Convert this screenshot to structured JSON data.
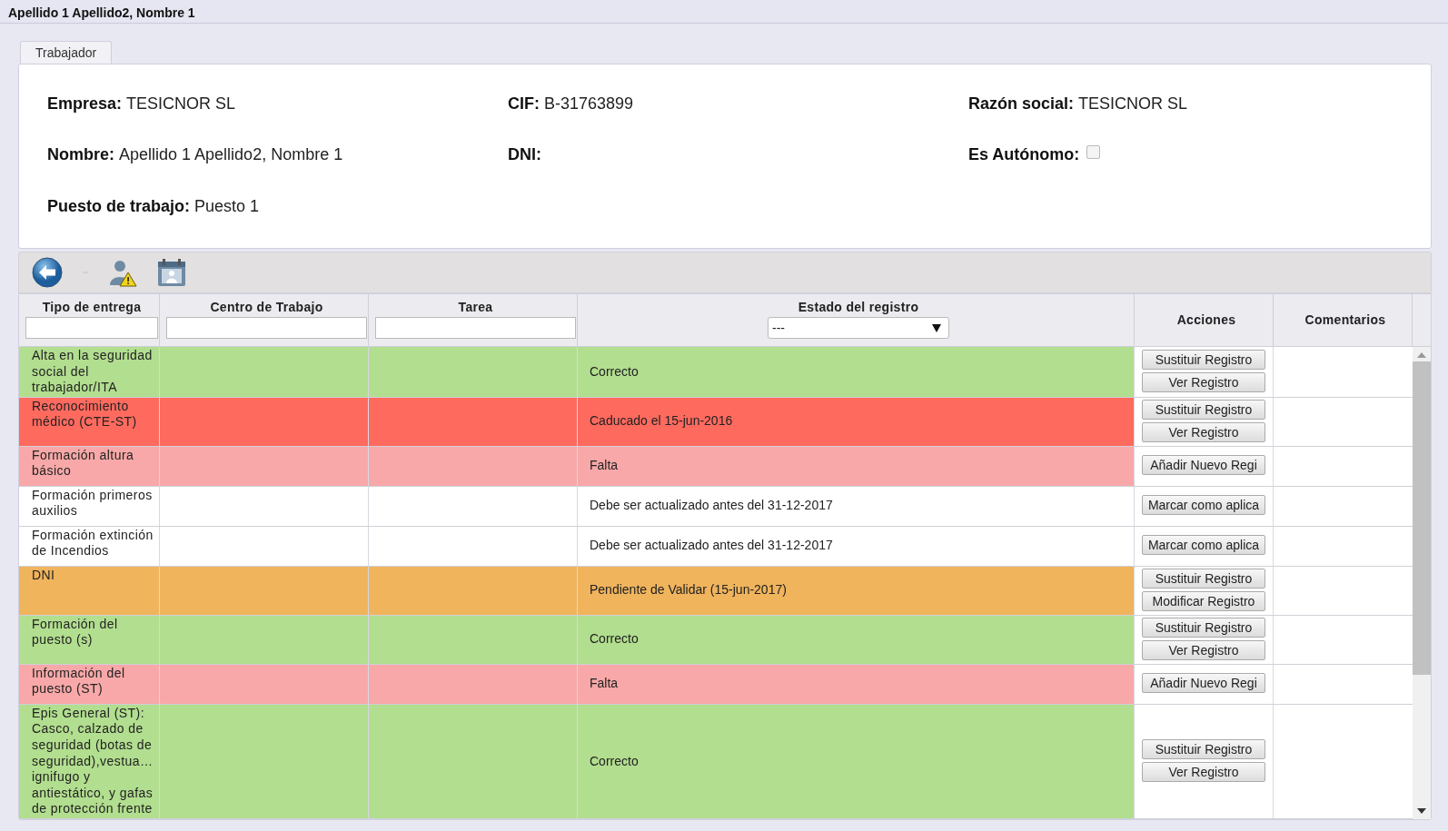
{
  "window": {
    "title": "Apellido 1 Apellido2, Nombre 1"
  },
  "tabs": [
    {
      "label": "Trabajador",
      "selected": true
    }
  ],
  "info": [
    {
      "kind": "text",
      "label": "Empresa:",
      "value": "TESICNOR SL"
    },
    {
      "kind": "text",
      "label": "CIF:",
      "value": "B-31763899"
    },
    {
      "kind": "text",
      "label": "Razón social:",
      "value": "TESICNOR SL"
    },
    {
      "kind": "text",
      "label": "Nombre:",
      "value": "Apellido 1 Apellido2, Nombre 1"
    },
    {
      "kind": "text",
      "label": "DNI:"
    },
    {
      "kind": "checkbox",
      "label": "Es Autónomo:",
      "checked": false
    },
    {
      "kind": "text",
      "label": "Puesto de trabajo:",
      "value": "Puesto 1"
    }
  ],
  "table": {
    "columns": [
      {
        "label": "Tipo de entrega",
        "kind": "text-filter"
      },
      {
        "label": "Centro de Trabajo",
        "kind": "text-filter"
      },
      {
        "label": "Tarea",
        "kind": "text-filter"
      },
      {
        "label": "Estado del registro",
        "kind": "select-filter",
        "value": "---"
      },
      {
        "label": "Acciones",
        "kind": "plain"
      },
      {
        "label": "Comentarios",
        "kind": "plain"
      }
    ],
    "rows": [
      {
        "tipo": "Alta en la seguridad social del trabajador/ITA",
        "estado": "Correcto",
        "color": "#b2de8f",
        "actions": [
          "Sustituir Registro",
          "Ver Registro"
        ]
      },
      {
        "tipo": "Reconocimiento médico (CTE-ST)",
        "estado": "Caducado el 15-jun-2016",
        "color": "#ff6a5f",
        "actions": [
          "Sustituir Registro",
          "Ver Registro"
        ]
      },
      {
        "tipo": "Formación altura básico",
        "estado": "Falta",
        "color": "#f8a8a8",
        "actions": [
          "Añadir Nuevo Regi"
        ]
      },
      {
        "tipo": "Formación primeros auxilios",
        "estado": "Debe ser actualizado antes del 31-12-2017",
        "color": "#ffffff",
        "actions": [
          "Marcar como aplica"
        ]
      },
      {
        "tipo": "Formación extinción de Incendios",
        "estado": "Debe ser actualizado antes del 31-12-2017",
        "color": "#ffffff",
        "actions": [
          "Marcar como aplica"
        ]
      },
      {
        "tipo": "DNI",
        "estado": "Pendiente de Validar (15-jun-2017)",
        "color": "#f0b45d",
        "actions": [
          "Sustituir Registro",
          "Modificar Registro"
        ]
      },
      {
        "tipo": "Formación del puesto (s)",
        "estado": "Correcto",
        "color": "#b2de8f",
        "actions": [
          "Sustituir Registro",
          "Ver Registro"
        ]
      },
      {
        "tipo": "Información del puesto (ST)",
        "estado": "Falta",
        "color": "#f8a8a8",
        "actions": [
          "Añadir Nuevo Regi"
        ]
      },
      {
        "tipo": "Epis General (ST): Casco, calzado de seguridad (botas de seguridad),vestua… ignifugo y antiestático, y gafas de protección frente",
        "estado": "Correcto",
        "color": "#b2de8f",
        "actions": [
          "Sustituir Registro",
          "Ver Registro"
        ]
      }
    ]
  }
}
